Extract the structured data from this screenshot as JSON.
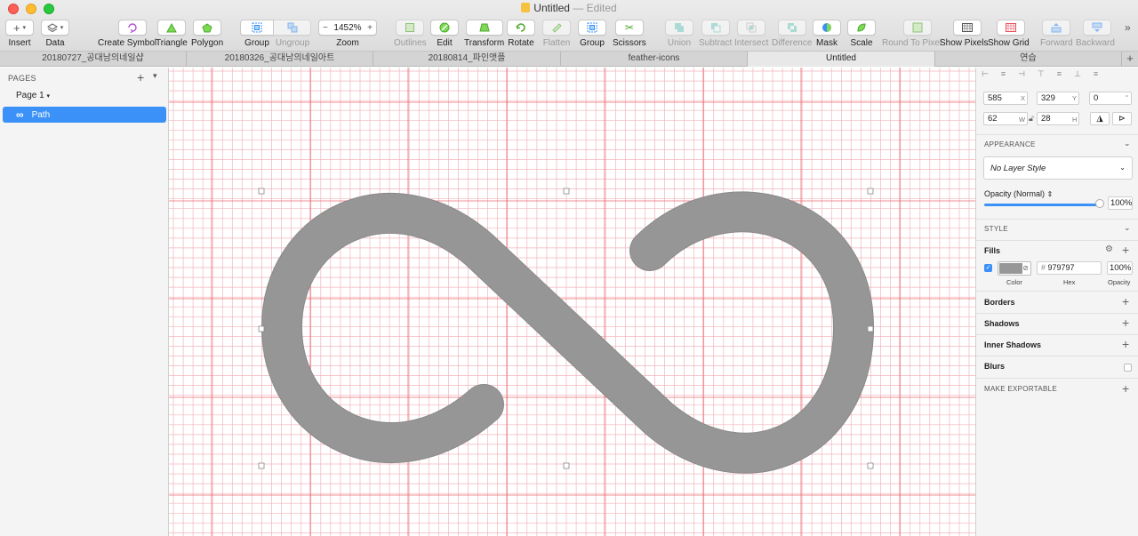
{
  "window": {
    "title": "Untitled",
    "status": "— Edited"
  },
  "toolbar": {
    "insert": "Insert",
    "data": "Data",
    "create_symbol": "Create Symbol",
    "triangle": "Triangle",
    "polygon": "Polygon",
    "group": "Group",
    "ungroup": "Ungroup",
    "zoom_value": "1452%",
    "zoom": "Zoom",
    "outlines": "Outlines",
    "edit": "Edit",
    "transform": "Transform",
    "rotate": "Rotate",
    "flatten": "Flatten",
    "group2": "Group",
    "scissors": "Scissors",
    "union": "Union",
    "subtract": "Subtract",
    "intersect": "Intersect",
    "difference": "Difference",
    "mask": "Mask",
    "scale": "Scale",
    "round_to_pixel": "Round To Pixel",
    "show_pixels": "Show Pixels",
    "show_grid": "Show Grid",
    "forward": "Forward",
    "backward": "Backward",
    "more": "»"
  },
  "tabs": [
    {
      "label": "20180727_공대남의네일샵"
    },
    {
      "label": "20180326_공대남의네일아트"
    },
    {
      "label": "20180814_파인앳플"
    },
    {
      "label": "feather-icons"
    },
    {
      "label": "Untitled"
    },
    {
      "label": "연습"
    }
  ],
  "sidebar": {
    "pages_header": "PAGES",
    "page_name": "Page 1",
    "layer_name": "Path"
  },
  "inspector": {
    "x": "585",
    "x_label": "X",
    "y": "329",
    "y_label": "Y",
    "rotation": "0",
    "rotation_label": "°",
    "w": "62",
    "w_label": "W",
    "h": "28",
    "h_label": "H",
    "appearance_header": "APPEARANCE",
    "layer_style": "No Layer Style",
    "opacity_label": "Opacity (Normal)",
    "opacity_value": "100%",
    "style_header": "STYLE",
    "fills": "Fills",
    "hex_prefix": "#",
    "hex": "979797",
    "fill_opacity": "100%",
    "color_label": "Color",
    "hex_label": "Hex",
    "opacity_col_label": "Opacity",
    "borders": "Borders",
    "shadows": "Shadows",
    "inner_shadows": "Inner Shadows",
    "blurs": "Blurs",
    "make_exportable": "MAKE EXPORTABLE"
  },
  "colors": {
    "selection": "#3b91f7",
    "fill": "#979797",
    "pixel_grid": "#f3b5bd",
    "major_grid": "#e8505b"
  }
}
